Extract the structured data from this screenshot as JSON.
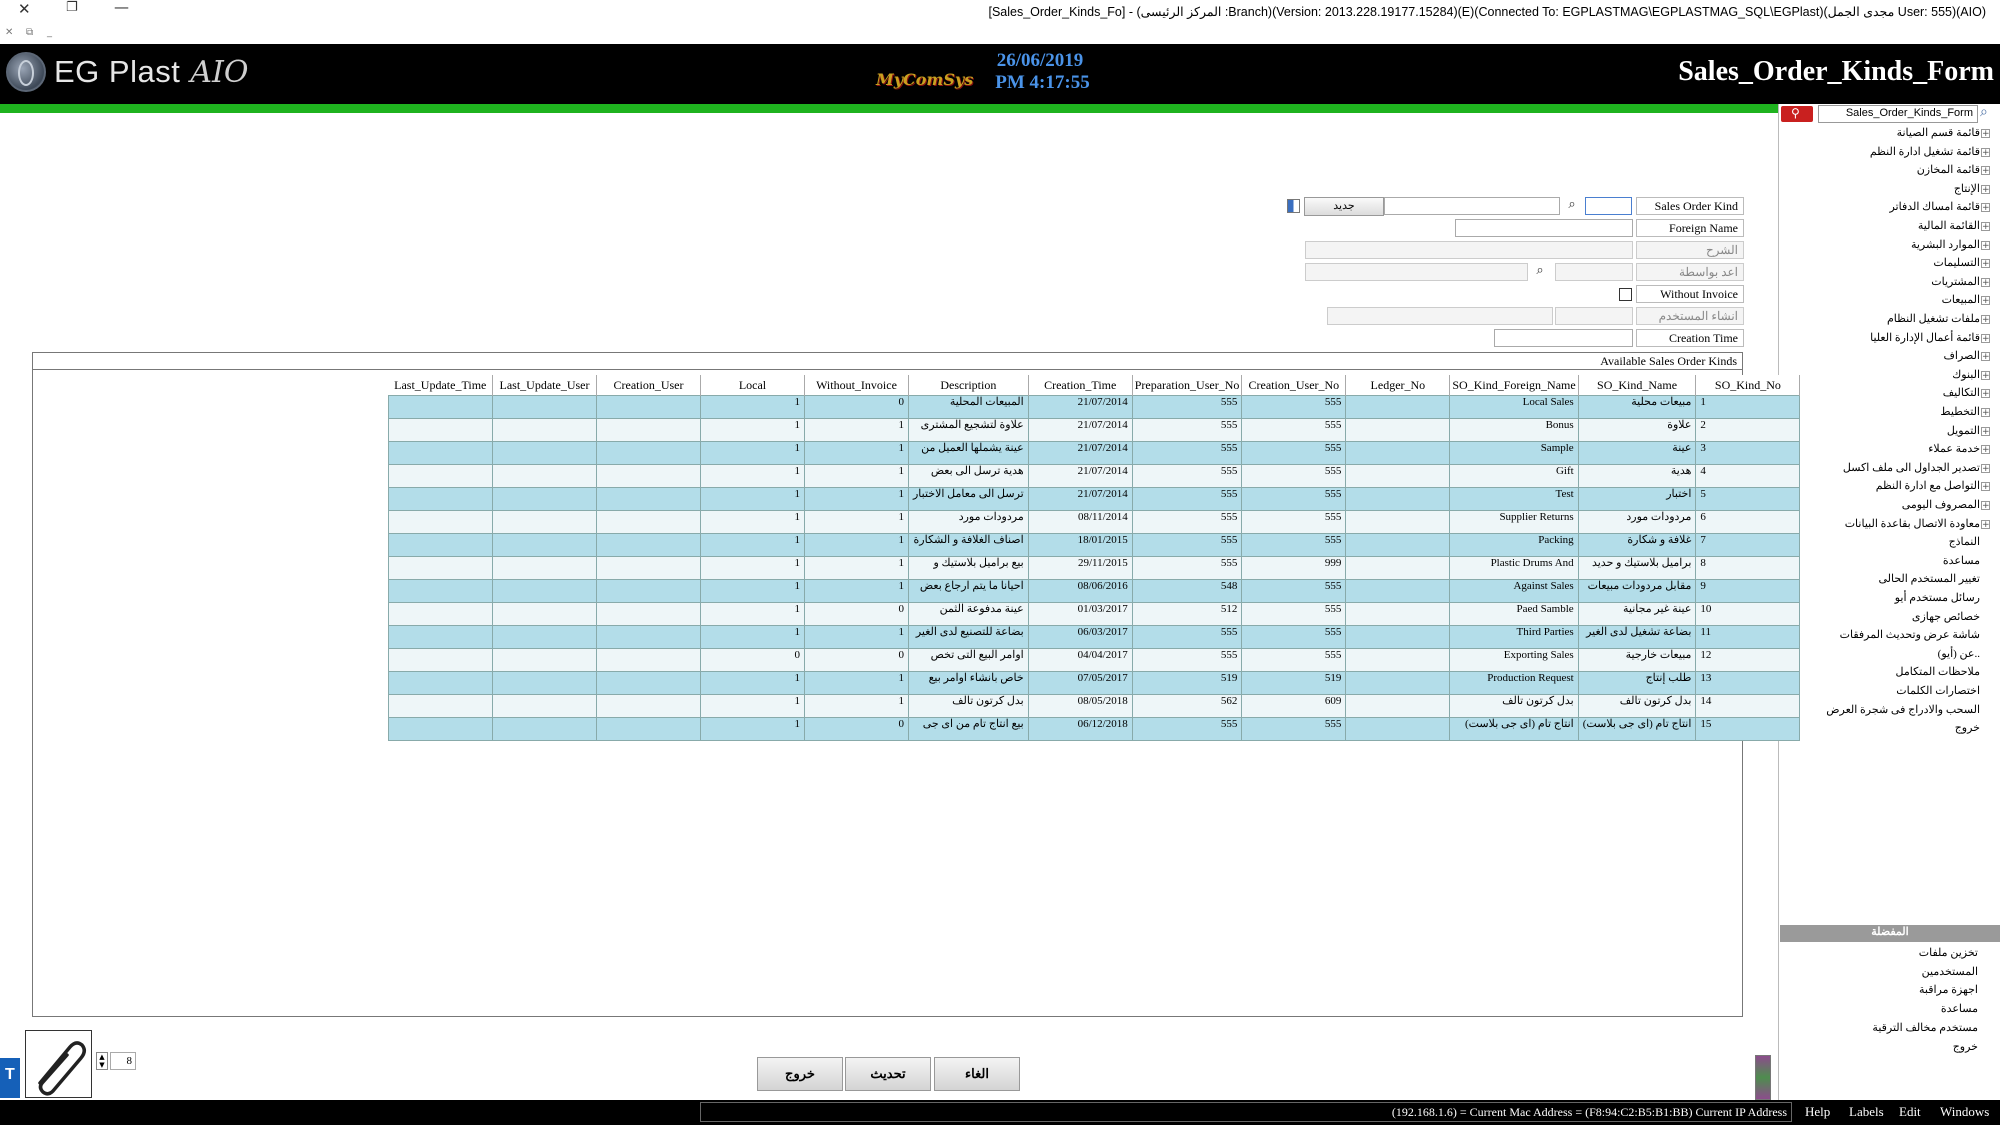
{
  "window": {
    "title": "[Sales_Order_Kinds_Fo] - (المركز الرئيسى :Branch)(Version: 2013.228.19177.15284)(E)(Connected To: EGPLASTMAG\\EGPLASTMAG_SQL\\EGPlast)(مجدى الجمل User: 555)(AIO)"
  },
  "header": {
    "app_name": "EG Plast",
    "app_suffix": "AIO",
    "vendor": "MyComSys",
    "date": "26/06/2019",
    "time": "PM 4:17:55",
    "form_title": "Sales_Order_Kinds_Form"
  },
  "colors": {
    "header_bg": "#000000",
    "accent_green": "#1fb31f",
    "row_highlight": "#b3dde9",
    "search_red": "#c9201f"
  },
  "side": {
    "search_value": "Sales_Order_Kinds_Form",
    "tree": [
      "قائمة قسم الصيانة",
      "قائمة تشغيل ادارة النظم",
      "قائمة المخازن",
      "الإنتاج",
      "قائمة امساك الدفاتر",
      "القائمة المالية",
      "الموارد البشرية",
      "التسليمات",
      "المشتريات",
      "المبيعات",
      "ملفات تشغيل النظام",
      "قائمة أعمال الإدارة العليا",
      "الصراف",
      "البنوك",
      "التكاليف",
      "التخطيط",
      "التمويل",
      "خدمة عملاء",
      "تصدير الجداول الى ملف اكسل",
      "التواصل مع ادارة النظم",
      "المصروف اليومى",
      "معاودة الاتصال بقاعدة البيانات",
      "النماذج",
      "مساعدة",
      "تغيير المستخدم الحالى",
      "رسائل مستخدم أيو",
      "خصائص جهازى",
      "شاشة عرض وتحديث المرفقات",
      "عن (أيو)..",
      "ملاحظات المتكامل",
      "اختصارات الكلمات",
      "السحب والادراج فى شجرة العرض",
      "خروج"
    ],
    "favorites_header": "المفضلة",
    "favorites": [
      "تخزين ملفات",
      "المستخدمين",
      "اجهزة مراقبة",
      "مساعدة",
      "مستخدم مخالف الترقية",
      "خروج"
    ]
  },
  "form": {
    "sales_order_kind_label": "Sales Order Kind",
    "sales_order_kind_value": "",
    "new_button": "جديد",
    "foreign_name_label": "Foreign Name",
    "description_label": "الشرح",
    "created_by_label": "اعد بواسطة",
    "without_invoice_label": "Without Invoice",
    "created_user_label": "انشاء المستخدم",
    "creation_time_label": "Creation Time",
    "grid_caption": "Available Sales Order Kinds"
  },
  "grid": {
    "columns": [
      "Last_Update_Time",
      "Last_Update_User",
      "Creation_User",
      "Local",
      "Without_Invoice",
      "Description",
      "Creation_Time",
      "Preparation_User_No",
      "Creation_User_No",
      "Ledger_No",
      "SO_Kind_Foreign_Name",
      "SO_Kind_Name",
      "SO_Kind_No"
    ],
    "rows": [
      {
        "no": "1",
        "name": "مبيعات محلية",
        "foreign": "Local Sales",
        "ledger": "",
        "cu": "555",
        "pu": "555",
        "ctime": "21/07/2014",
        "desc": "المبيعات المحلية",
        "wi": "0",
        "local": "1",
        "cuser": "",
        "luser": "",
        "ltime": ""
      },
      {
        "no": "2",
        "name": "علاوة",
        "foreign": "Bonus",
        "ledger": "",
        "cu": "555",
        "pu": "555",
        "ctime": "21/07/2014",
        "desc": "علاوة لتشجيع المشترى",
        "wi": "1",
        "local": "1",
        "cuser": "",
        "luser": "",
        "ltime": ""
      },
      {
        "no": "3",
        "name": "عينة",
        "foreign": "Sample",
        "ledger": "",
        "cu": "555",
        "pu": "555",
        "ctime": "21/07/2014",
        "desc": "عينة يشملها العميل من",
        "wi": "1",
        "local": "1",
        "cuser": "",
        "luser": "",
        "ltime": ""
      },
      {
        "no": "4",
        "name": "هدية",
        "foreign": "Gift",
        "ledger": "",
        "cu": "555",
        "pu": "555",
        "ctime": "21/07/2014",
        "desc": "هدية ترسل الى بعض",
        "wi": "1",
        "local": "1",
        "cuser": "",
        "luser": "",
        "ltime": ""
      },
      {
        "no": "5",
        "name": "اختبار",
        "foreign": "Test",
        "ledger": "",
        "cu": "555",
        "pu": "555",
        "ctime": "21/07/2014",
        "desc": "ترسل الى معامل الاختبار",
        "wi": "1",
        "local": "1",
        "cuser": "",
        "luser": "",
        "ltime": ""
      },
      {
        "no": "6",
        "name": "مردودات مورد",
        "foreign": "Supplier Returns",
        "ledger": "",
        "cu": "555",
        "pu": "555",
        "ctime": "08/11/2014",
        "desc": "مردودات مورد",
        "wi": "1",
        "local": "1",
        "cuser": "",
        "luser": "",
        "ltime": ""
      },
      {
        "no": "7",
        "name": "غلافة و شكارة",
        "foreign": "Packing",
        "ledger": "",
        "cu": "555",
        "pu": "555",
        "ctime": "18/01/2015",
        "desc": "اصناف الغلافة و الشكارة",
        "wi": "1",
        "local": "1",
        "cuser": "",
        "luser": "",
        "ltime": ""
      },
      {
        "no": "8",
        "name": "براميل بلاستيك و حديد",
        "foreign": "Plastic Drums And",
        "ledger": "",
        "cu": "999",
        "pu": "555",
        "ctime": "29/11/2015",
        "desc": "بيع براميل بلاستيك و",
        "wi": "1",
        "local": "1",
        "cuser": "",
        "luser": "",
        "ltime": ""
      },
      {
        "no": "9",
        "name": "مقابل مردودات مبيعات",
        "foreign": "Against Sales",
        "ledger": "",
        "cu": "555",
        "pu": "548",
        "ctime": "08/06/2016",
        "desc": "احيانا ما يتم ارجاع بعض",
        "wi": "1",
        "local": "1",
        "cuser": "",
        "luser": "",
        "ltime": ""
      },
      {
        "no": "10",
        "name": "عينة غير مجانية",
        "foreign": "Paed Samble",
        "ledger": "",
        "cu": "555",
        "pu": "512",
        "ctime": "01/03/2017",
        "desc": "عينة مدفوعة الثمن",
        "wi": "0",
        "local": "1",
        "cuser": "",
        "luser": "",
        "ltime": ""
      },
      {
        "no": "11",
        "name": "بضاعة تشغيل لدى الغير",
        "foreign": "Third Parties",
        "ledger": "",
        "cu": "555",
        "pu": "555",
        "ctime": "06/03/2017",
        "desc": "بضاعة للتصنيع لدى الغير",
        "wi": "1",
        "local": "1",
        "cuser": "",
        "luser": "",
        "ltime": ""
      },
      {
        "no": "12",
        "name": "مبيعات خارجية",
        "foreign": "Exporting Sales",
        "ledger": "",
        "cu": "555",
        "pu": "555",
        "ctime": "04/04/2017",
        "desc": "اوامر البيع التى تخص",
        "wi": "0",
        "local": "0",
        "cuser": "",
        "luser": "",
        "ltime": ""
      },
      {
        "no": "13",
        "name": "طلب إنتاج",
        "foreign": "Production Request",
        "ledger": "",
        "cu": "519",
        "pu": "519",
        "ctime": "07/05/2017",
        "desc": "خاص بانشاء اوامر بيع",
        "wi": "1",
        "local": "1",
        "cuser": "",
        "luser": "",
        "ltime": ""
      },
      {
        "no": "14",
        "name": "بدل كرتون تالف",
        "foreign": "بدل كرتون تالف",
        "ledger": "",
        "cu": "609",
        "pu": "562",
        "ctime": "08/05/2018",
        "desc": "بدل كرتون تالف",
        "wi": "1",
        "local": "1",
        "cuser": "",
        "luser": "",
        "ltime": ""
      },
      {
        "no": "15",
        "name": "انتاج تام (اى جى بلاست)",
        "foreign": "انتاج تام (اى جى بلاست)",
        "ledger": "",
        "cu": "555",
        "pu": "555",
        "ctime": "06/12/2018",
        "desc": "بيع انتاج تام من اى جى",
        "wi": "0",
        "local": "1",
        "cuser": "",
        "luser": "",
        "ltime": ""
      }
    ]
  },
  "bottom": {
    "page_value": "8",
    "cancel_button": "الغاء",
    "refresh_button": "تحديث",
    "exit_button": "خروج",
    "tag_letter": "T"
  },
  "status": {
    "ip_text": "(192.168.1.6) = Current Mac Address = (F8:94:C2:B5:B1:BB) Current IP Address",
    "menus": [
      "Help",
      "Labels",
      "Edit",
      "Windows"
    ]
  }
}
